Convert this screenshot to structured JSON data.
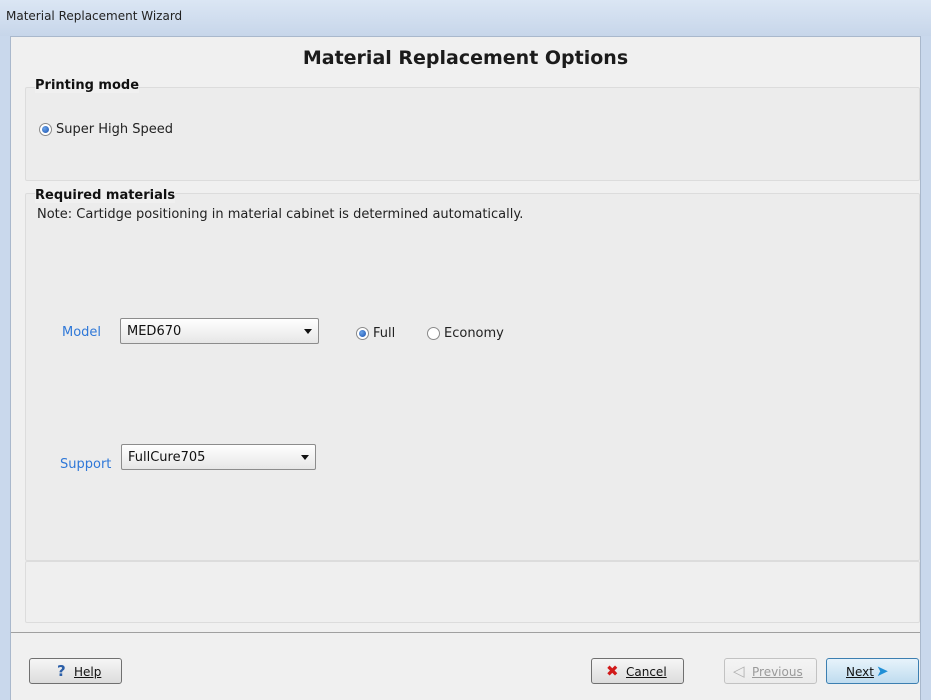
{
  "window": {
    "title": "Material Replacement Wizard"
  },
  "page": {
    "title": "Material Replacement Options"
  },
  "printing_mode": {
    "title": "Printing mode",
    "option": {
      "label": "Super High Speed",
      "checked": true
    }
  },
  "required_materials": {
    "title": "Required materials",
    "note": "Note: Cartidge positioning in material cabinet is determined automatically.",
    "model": {
      "label": "Model",
      "value": "MED670",
      "options": [
        {
          "label": "Full",
          "checked": true
        },
        {
          "label": "Economy",
          "checked": false
        }
      ]
    },
    "support": {
      "label": "Support",
      "value": "FullCure705"
    }
  },
  "buttons": {
    "help": {
      "icon": "?",
      "label": "Help"
    },
    "cancel": {
      "icon": "✖",
      "label": "Cancel"
    },
    "previous": {
      "icon": "◁",
      "label": "Previous",
      "enabled": false
    },
    "next": {
      "icon": "➤",
      "label": "Next"
    }
  },
  "colors": {
    "title_bar": "#c7d6ea",
    "field_label": "#2f78d8",
    "radio_selected": "#1a52b0",
    "cancel_icon": "#d11a1a",
    "next_arrow": "#1f8fd6"
  }
}
